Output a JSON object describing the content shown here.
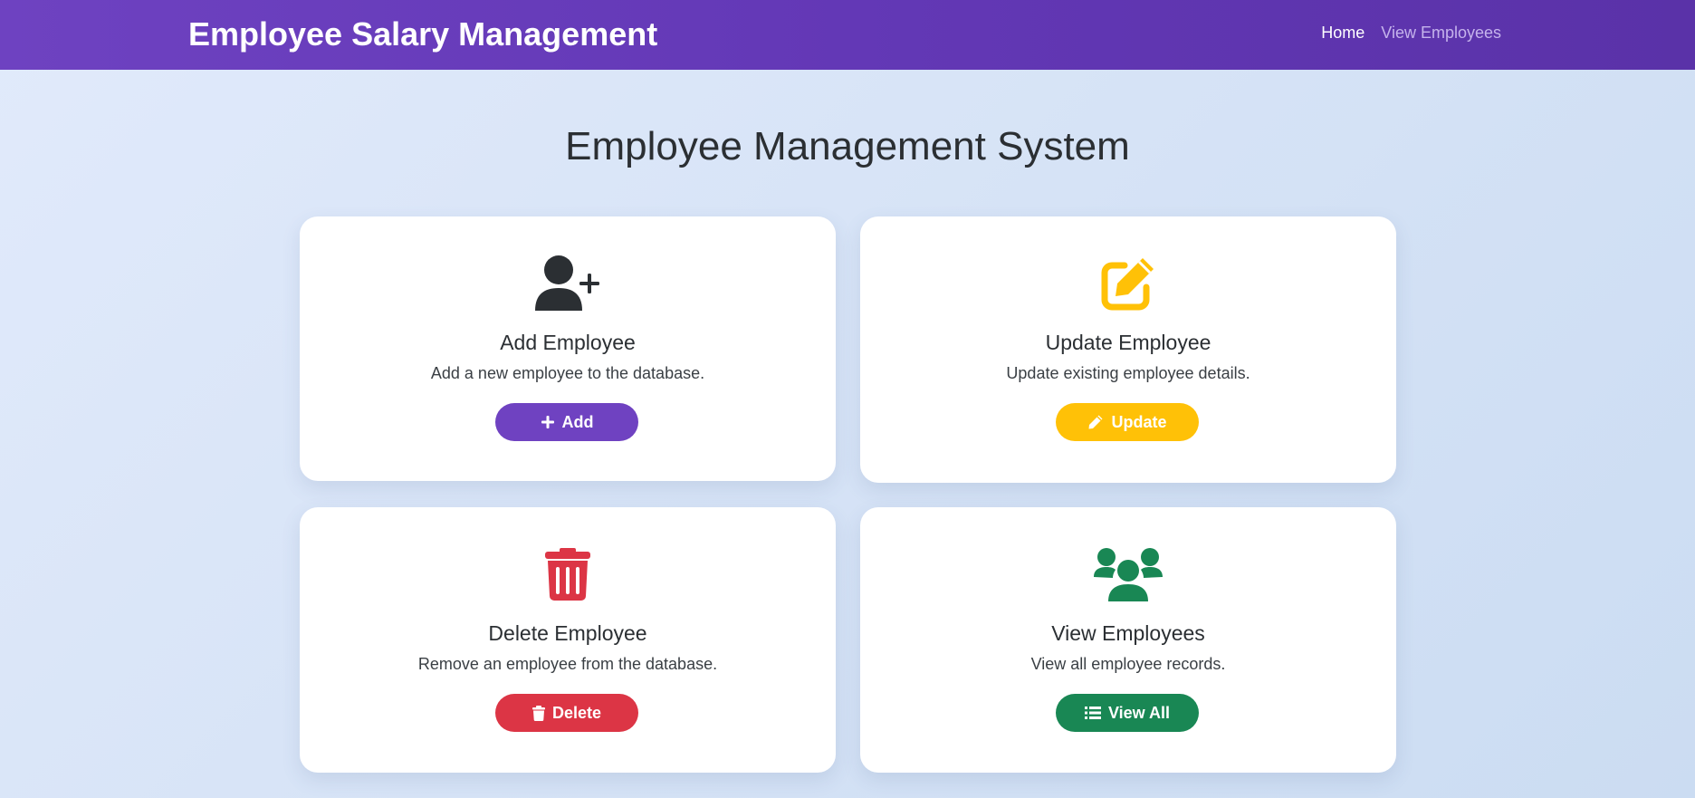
{
  "navbar": {
    "brand": "Employee Salary Management",
    "links": [
      {
        "label": "Home",
        "active": true
      },
      {
        "label": "View Employees",
        "active": false
      }
    ]
  },
  "main": {
    "title": "Employee Management System"
  },
  "cards": [
    {
      "title": "Add Employee",
      "description": "Add a new employee to the database.",
      "button_label": "Add",
      "icon": "user-plus-icon",
      "color": "#6f42c1"
    },
    {
      "title": "Update Employee",
      "description": "Update existing employee details.",
      "button_label": "Update",
      "icon": "edit-icon",
      "color": "#ffc107"
    },
    {
      "title": "Delete Employee",
      "description": "Remove an employee from the database.",
      "button_label": "Delete",
      "icon": "trash-icon",
      "color": "#dc3545"
    },
    {
      "title": "View Employees",
      "description": "View all employee records.",
      "button_label": "View All",
      "icon": "users-icon",
      "color": "#198754"
    }
  ]
}
